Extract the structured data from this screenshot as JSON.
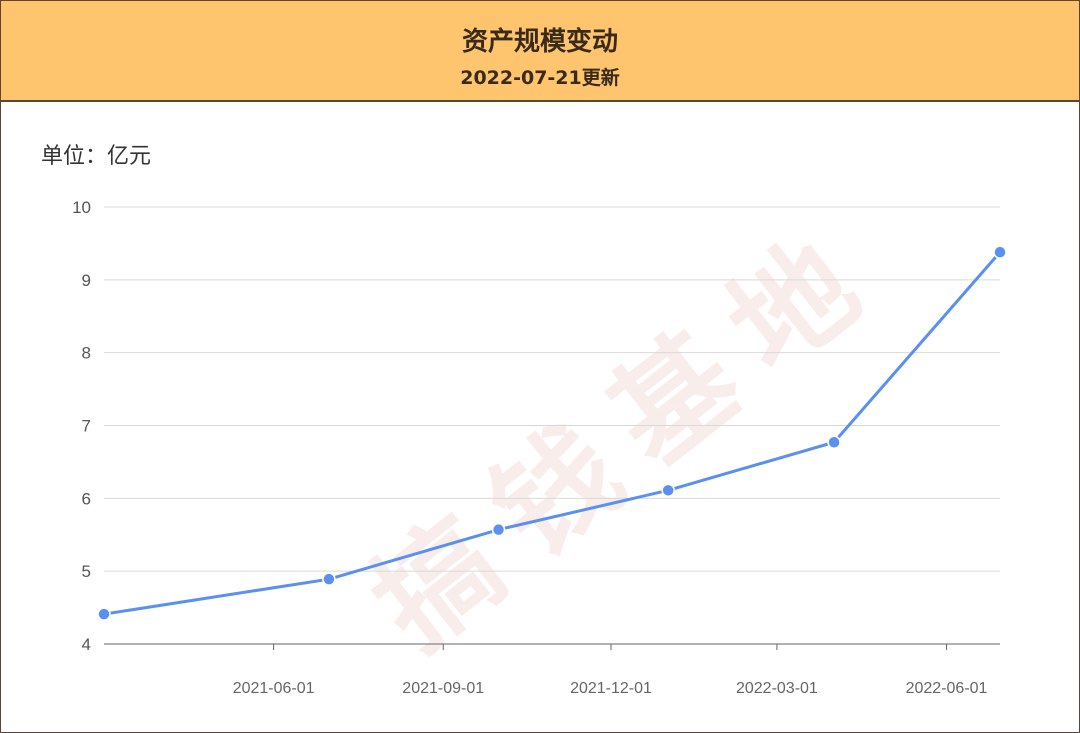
{
  "header": {
    "title": "资产规模变动",
    "subtitle": "2022-07-21更新"
  },
  "unit_label": "单位：亿元",
  "watermark": "搞钱基地",
  "colors": {
    "header_bg": "#ffc46e",
    "line": "#5b8ff0",
    "grid": "#d9d9d9"
  },
  "chart_data": {
    "type": "line",
    "title": "资产规模变动",
    "subtitle": "2022-07-21更新",
    "ylabel": "单位：亿元",
    "ylim": [
      4,
      10
    ],
    "yticks": [
      4,
      5,
      6,
      7,
      8,
      9,
      10
    ],
    "xlim": [
      "2021-03-01",
      "2022-06-30"
    ],
    "xticks": [
      "2021-06-01",
      "2021-09-01",
      "2021-12-01",
      "2022-03-01",
      "2022-06-01"
    ],
    "grid": true,
    "series": [
      {
        "x": [
          "2021-03-01",
          "2021-07-01",
          "2021-10-01",
          "2022-01-01",
          "2022-04-01",
          "2022-06-30"
        ],
        "values": [
          4.41,
          4.89,
          5.57,
          6.11,
          6.77,
          9.38
        ]
      }
    ]
  }
}
